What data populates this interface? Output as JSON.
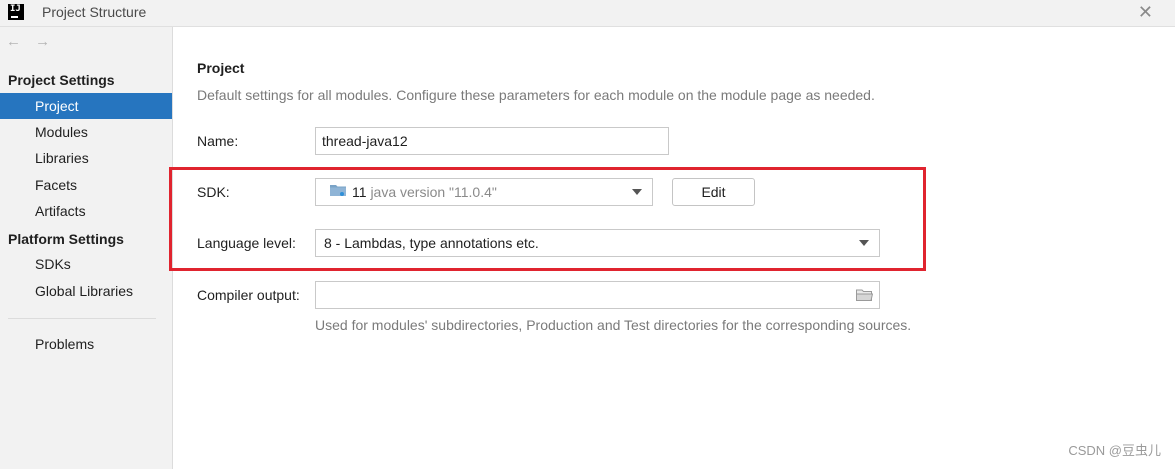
{
  "window": {
    "title": "Project Structure",
    "app_icon_text": "IJ",
    "close_glyph": "✕"
  },
  "nav": {
    "back": "←",
    "forward": "→"
  },
  "sidebar": {
    "project_settings_header": "Project Settings",
    "project_settings_items": [
      "Project",
      "Modules",
      "Libraries",
      "Facets",
      "Artifacts"
    ],
    "platform_settings_header": "Platform Settings",
    "platform_settings_items": [
      "SDKs",
      "Global Libraries"
    ],
    "other_items": [
      "Problems"
    ],
    "selected": "Project"
  },
  "main": {
    "title": "Project",
    "description": "Default settings for all modules. Configure these parameters for each module on the module page as needed.",
    "name_label": "Name:",
    "name_value": "thread-java12",
    "sdk_label": "SDK:",
    "sdk_version": "11",
    "sdk_description": "java version \"11.0.4\"",
    "sdk_icon": "folder-icon",
    "edit_button": "Edit",
    "language_level_label": "Language level:",
    "language_level_value": "8 - Lambdas, type annotations etc.",
    "compiler_output_label": "Compiler output:",
    "compiler_output_value": "",
    "compiler_output_hint": "Used for modules' subdirectories, Production and Test directories for the corresponding sources."
  },
  "colors": {
    "selection": "#2675bf",
    "highlight_box": "#e0242f",
    "sidebar_bg": "#f2f2f2"
  },
  "watermark": "CSDN @豆虫儿"
}
